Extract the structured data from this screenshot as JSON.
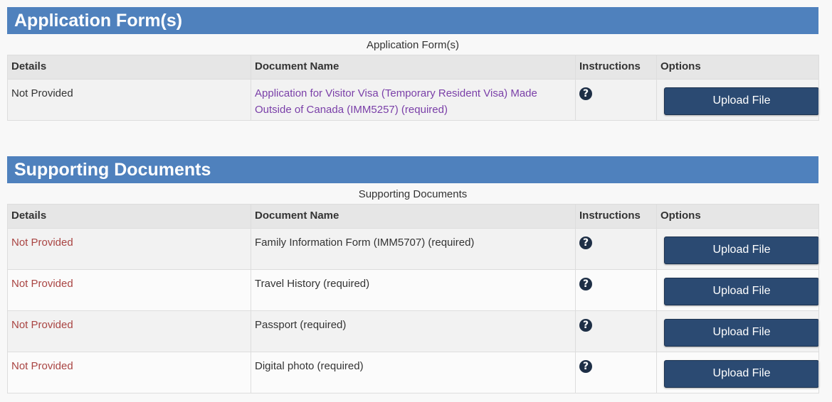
{
  "sections": [
    {
      "title": "Application Form(s)",
      "caption": "Application Form(s)",
      "columns": [
        "Details",
        "Document Name",
        "Instructions",
        "Options"
      ],
      "rows": [
        {
          "details": "Not Provided",
          "document_name": "Application for Visitor Visa (Temporary Resident Visa) Made Outside of Canada (IMM5257)  (required)",
          "instructions_icon": "question-circle-icon",
          "option_label": "Upload File"
        }
      ]
    },
    {
      "title": "Supporting Documents",
      "caption": "Supporting Documents",
      "columns": [
        "Details",
        "Document Name",
        "Instructions",
        "Options"
      ],
      "rows": [
        {
          "details": "Not Provided",
          "document_name": "Family Information Form (IMM5707)  (required)",
          "instructions_icon": "question-circle-icon",
          "option_label": "Upload File"
        },
        {
          "details": "Not Provided",
          "document_name": "Travel History  (required)",
          "instructions_icon": "question-circle-icon",
          "option_label": "Upload File"
        },
        {
          "details": "Not Provided",
          "document_name": "Passport  (required)",
          "instructions_icon": "question-circle-icon",
          "option_label": "Upload File"
        },
        {
          "details": "Not Provided",
          "document_name": "Digital photo  (required)",
          "instructions_icon": "question-circle-icon",
          "option_label": "Upload File"
        }
      ]
    }
  ],
  "colors": {
    "header_bg": "#4f81bd",
    "button_bg": "#2b4a72",
    "link": "#7a3fa8",
    "not_provided_red": "#a94442"
  }
}
